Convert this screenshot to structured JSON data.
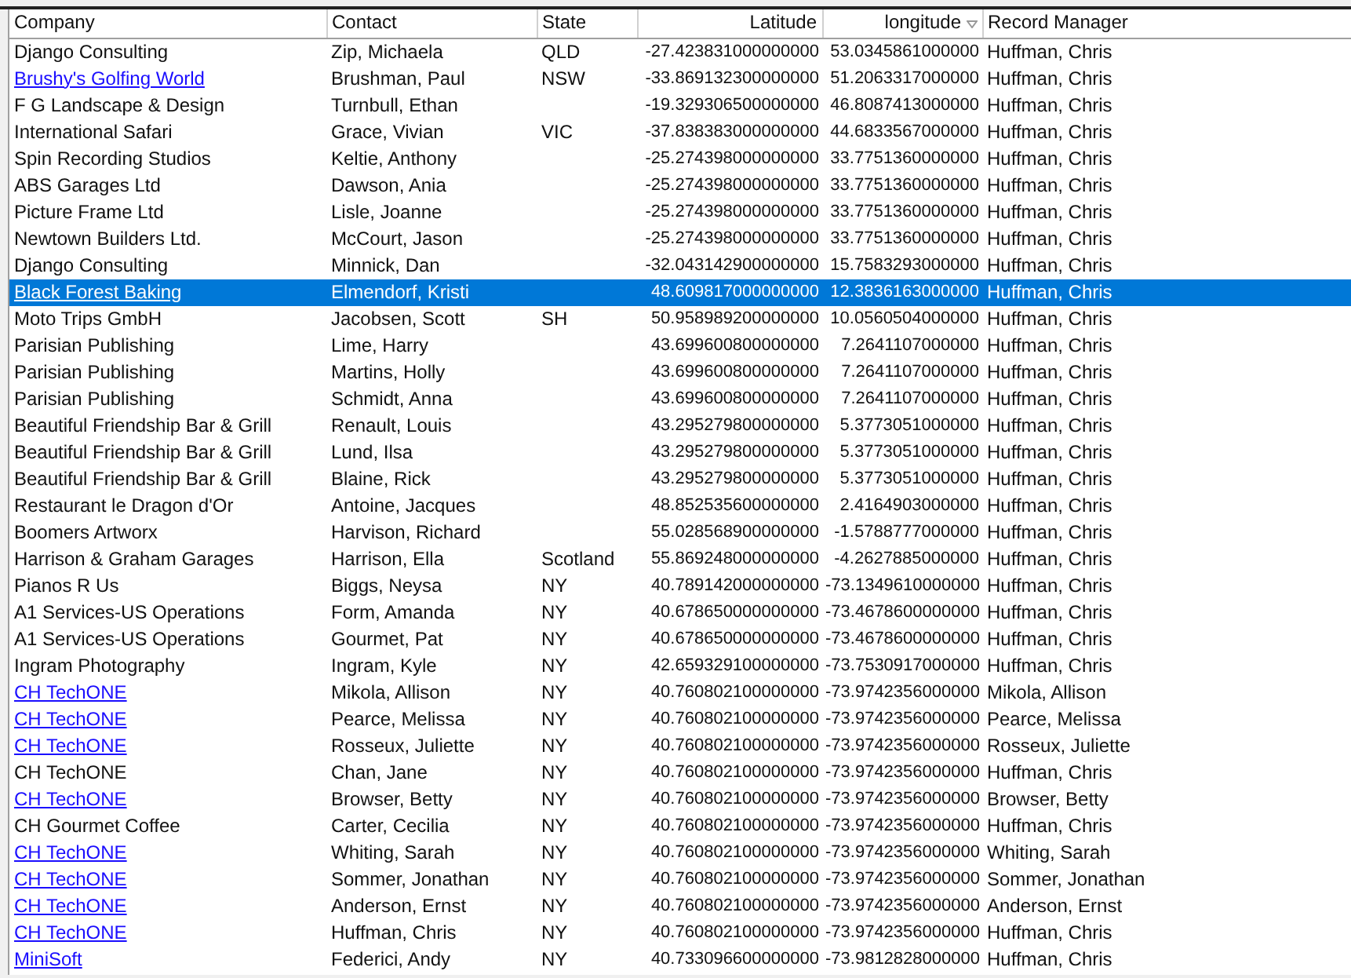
{
  "table": {
    "columns": [
      {
        "label": "Company",
        "kind": "text",
        "sorted": false
      },
      {
        "label": "Contact",
        "kind": "text",
        "sorted": false
      },
      {
        "label": "State",
        "kind": "text",
        "sorted": false
      },
      {
        "label": "Latitude",
        "kind": "number",
        "sorted": false
      },
      {
        "label": "longitude",
        "kind": "number",
        "sorted": true
      },
      {
        "label": "Record Manager",
        "kind": "text",
        "sorted": false
      }
    ],
    "rows": [
      {
        "company": "Django Consulting",
        "link": false,
        "contact": "Zip, Michaela",
        "state": "QLD",
        "latitude": "-27.423831000000000",
        "longitude": "53.0345861000000",
        "manager": "Huffman, Chris",
        "selected": false
      },
      {
        "company": "Brushy's Golfing World",
        "link": true,
        "contact": "Brushman, Paul",
        "state": "NSW",
        "latitude": "-33.869132300000000",
        "longitude": "51.2063317000000",
        "manager": "Huffman, Chris",
        "selected": false
      },
      {
        "company": "F G Landscape & Design",
        "link": false,
        "contact": "Turnbull, Ethan",
        "latitude": "-19.329306500000000",
        "longitude": "46.8087413000000",
        "manager": "Huffman, Chris",
        "selected": false
      },
      {
        "company": "International Safari",
        "link": false,
        "contact": "Grace, Vivian",
        "state": "VIC",
        "latitude": "-37.838383000000000",
        "longitude": "44.6833567000000",
        "manager": "Huffman, Chris",
        "selected": false
      },
      {
        "company": "Spin Recording Studios",
        "link": false,
        "contact": "Keltie, Anthony",
        "latitude": "-25.274398000000000",
        "longitude": "33.7751360000000",
        "manager": "Huffman, Chris",
        "selected": false
      },
      {
        "company": "ABS Garages Ltd",
        "link": false,
        "contact": "Dawson, Ania",
        "latitude": "-25.274398000000000",
        "longitude": "33.7751360000000",
        "manager": "Huffman, Chris",
        "selected": false
      },
      {
        "company": "Picture Frame Ltd",
        "link": false,
        "contact": "Lisle, Joanne",
        "latitude": "-25.274398000000000",
        "longitude": "33.7751360000000",
        "manager": "Huffman, Chris",
        "selected": false
      },
      {
        "company": "Newtown Builders Ltd.",
        "link": false,
        "contact": "McCourt, Jason",
        "latitude": "-25.274398000000000",
        "longitude": "33.7751360000000",
        "manager": "Huffman, Chris",
        "selected": false
      },
      {
        "company": "Django Consulting",
        "link": false,
        "contact": "Minnick, Dan",
        "latitude": "-32.043142900000000",
        "longitude": "15.7583293000000",
        "manager": "Huffman, Chris",
        "selected": false
      },
      {
        "company": "Black Forest Baking",
        "link": true,
        "contact": "Elmendorf, Kristi",
        "latitude": "48.609817000000000",
        "longitude": "12.3836163000000",
        "manager": "Huffman, Chris",
        "selected": true
      },
      {
        "company": "Moto Trips GmbH",
        "link": false,
        "contact": "Jacobsen, Scott",
        "state": "SH",
        "latitude": "50.958989200000000",
        "longitude": "10.0560504000000",
        "manager": "Huffman, Chris",
        "selected": false
      },
      {
        "company": "Parisian Publishing",
        "link": false,
        "contact": "Lime, Harry",
        "latitude": "43.699600800000000",
        "longitude": "7.2641107000000",
        "manager": "Huffman, Chris",
        "selected": false
      },
      {
        "company": "Parisian Publishing",
        "link": false,
        "contact": "Martins, Holly",
        "latitude": "43.699600800000000",
        "longitude": "7.2641107000000",
        "manager": "Huffman, Chris",
        "selected": false
      },
      {
        "company": "Parisian Publishing",
        "link": false,
        "contact": "Schmidt, Anna",
        "latitude": "43.699600800000000",
        "longitude": "7.2641107000000",
        "manager": "Huffman, Chris",
        "selected": false
      },
      {
        "company": "Beautiful Friendship Bar & Grill",
        "link": false,
        "contact": "Renault, Louis",
        "latitude": "43.295279800000000",
        "longitude": "5.3773051000000",
        "manager": "Huffman, Chris",
        "selected": false
      },
      {
        "company": "Beautiful Friendship Bar & Grill",
        "link": false,
        "contact": "Lund, Ilsa",
        "latitude": "43.295279800000000",
        "longitude": "5.3773051000000",
        "manager": "Huffman, Chris",
        "selected": false
      },
      {
        "company": "Beautiful Friendship Bar & Grill",
        "link": false,
        "contact": "Blaine, Rick",
        "latitude": "43.295279800000000",
        "longitude": "5.3773051000000",
        "manager": "Huffman, Chris",
        "selected": false
      },
      {
        "company": "Restaurant le Dragon d'Or",
        "link": false,
        "contact": "Antoine, Jacques",
        "latitude": "48.852535600000000",
        "longitude": "2.4164903000000",
        "manager": "Huffman, Chris",
        "selected": false
      },
      {
        "company": "Boomers Artworx",
        "link": false,
        "contact": "Harvison, Richard",
        "latitude": "55.028568900000000",
        "longitude": "-1.5788777000000",
        "manager": "Huffman, Chris",
        "selected": false
      },
      {
        "company": "Harrison & Graham Garages",
        "link": false,
        "contact": "Harrison, Ella",
        "state": "Scotland",
        "latitude": "55.869248000000000",
        "longitude": "-4.2627885000000",
        "manager": "Huffman, Chris",
        "selected": false
      },
      {
        "company": "Pianos R Us",
        "link": false,
        "contact": "Biggs, Neysa",
        "state": "NY",
        "latitude": "40.789142000000000",
        "longitude": "-73.1349610000000",
        "manager": "Huffman, Chris",
        "selected": false
      },
      {
        "company": "A1 Services-US Operations",
        "link": false,
        "contact": "Form, Amanda",
        "state": "NY",
        "latitude": "40.678650000000000",
        "longitude": "-73.4678600000000",
        "manager": "Huffman, Chris",
        "selected": false
      },
      {
        "company": "A1 Services-US Operations",
        "link": false,
        "contact": "Gourmet, Pat",
        "state": "NY",
        "latitude": "40.678650000000000",
        "longitude": "-73.4678600000000",
        "manager": "Huffman, Chris",
        "selected": false
      },
      {
        "company": "Ingram Photography",
        "link": false,
        "contact": "Ingram, Kyle",
        "state": "NY",
        "latitude": "42.659329100000000",
        "longitude": "-73.7530917000000",
        "manager": "Huffman, Chris",
        "selected": false
      },
      {
        "company": "CH TechONE",
        "link": true,
        "contact": "Mikola, Allison",
        "state": "NY",
        "latitude": "40.760802100000000",
        "longitude": "-73.9742356000000",
        "manager": "Mikola, Allison",
        "selected": false
      },
      {
        "company": "CH TechONE",
        "link": true,
        "contact": "Pearce, Melissa",
        "state": "NY",
        "latitude": "40.760802100000000",
        "longitude": "-73.9742356000000",
        "manager": "Pearce, Melissa",
        "selected": false
      },
      {
        "company": "CH TechONE",
        "link": true,
        "contact": "Rosseux, Juliette",
        "state": "NY",
        "latitude": "40.760802100000000",
        "longitude": "-73.9742356000000",
        "manager": "Rosseux, Juliette",
        "selected": false
      },
      {
        "company": "CH TechONE",
        "link": false,
        "contact": "Chan, Jane",
        "state": "NY",
        "latitude": "40.760802100000000",
        "longitude": "-73.9742356000000",
        "manager": "Huffman, Chris",
        "selected": false
      },
      {
        "company": "CH TechONE",
        "link": true,
        "contact": "Browser, Betty",
        "state": "NY",
        "latitude": "40.760802100000000",
        "longitude": "-73.9742356000000",
        "manager": "Browser, Betty",
        "selected": false
      },
      {
        "company": "CH Gourmet Coffee",
        "link": false,
        "contact": "Carter, Cecilia",
        "state": "NY",
        "latitude": "40.760802100000000",
        "longitude": "-73.9742356000000",
        "manager": "Huffman, Chris",
        "selected": false
      },
      {
        "company": "CH TechONE",
        "link": true,
        "contact": "Whiting, Sarah",
        "state": "NY",
        "latitude": "40.760802100000000",
        "longitude": "-73.9742356000000",
        "manager": "Whiting, Sarah",
        "selected": false
      },
      {
        "company": "CH TechONE",
        "link": true,
        "contact": "Sommer, Jonathan",
        "state": "NY",
        "latitude": "40.760802100000000",
        "longitude": "-73.9742356000000",
        "manager": "Sommer, Jonathan",
        "selected": false
      },
      {
        "company": "CH TechONE",
        "link": true,
        "contact": "Anderson, Ernst",
        "state": "NY",
        "latitude": "40.760802100000000",
        "longitude": "-73.9742356000000",
        "manager": "Anderson, Ernst",
        "selected": false
      },
      {
        "company": "CH TechONE",
        "link": true,
        "contact": "Huffman, Chris",
        "state": "NY",
        "latitude": "40.760802100000000",
        "longitude": "-73.9742356000000",
        "manager": "Huffman, Chris",
        "selected": false
      },
      {
        "company": "MiniSoft",
        "link": true,
        "contact": "Federici, Andy",
        "state": "NY",
        "latitude": "40.733096600000000",
        "longitude": "-73.9812828000000",
        "manager": "Huffman, Chris",
        "selected": false
      }
    ]
  }
}
